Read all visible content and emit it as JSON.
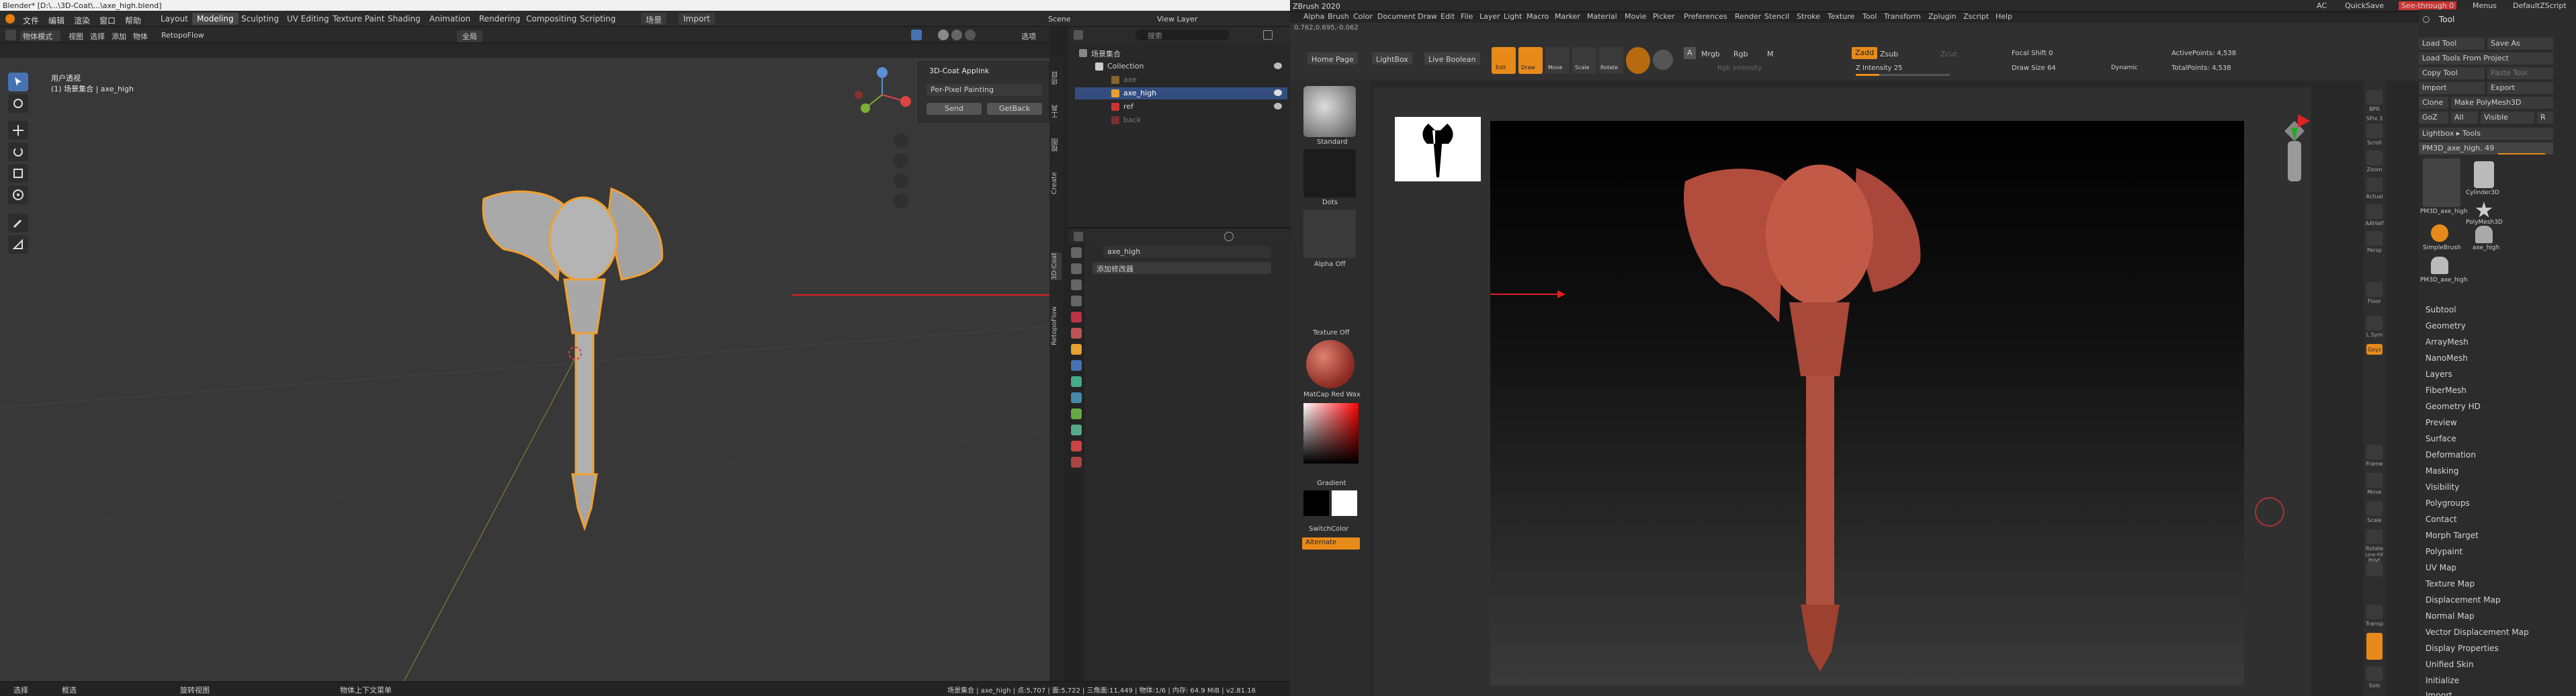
{
  "blender": {
    "window_title": "Blender* [D:\\...\\3D-Coat\\...\\axe_high.blend]",
    "menu": [
      "文件",
      "编辑",
      "渲染",
      "窗口",
      "帮助"
    ],
    "workspaces": [
      "Layout",
      "Modeling",
      "Sculpting",
      "UV Editing",
      "Texture Paint",
      "Shading",
      "Animation",
      "Rendering",
      "Compositing",
      "Scripting"
    ],
    "active_workspace": "Modeling",
    "header_buttons": [
      "场景",
      "Import"
    ],
    "scene_label": "Scene",
    "view_layer": "View Layer",
    "viewport": {
      "mode": "物体模式",
      "menus": [
        "视图",
        "选择",
        "添加",
        "物体"
      ],
      "addon_menu": "RetopoFlow",
      "view_name": "用户透视",
      "collection_info": "(1) 场景集合 | axe_high",
      "orientation": "全局"
    },
    "coat_panel": {
      "title": "3D-Coat Applink",
      "mode": "Per-Pixel Painting",
      "send": "Send",
      "getback": "GetBack",
      "option_label": "选项"
    },
    "sidebar_tabs": [
      "项目",
      "工具",
      "视图",
      "Create",
      "3D-Coat",
      "RetopoFlow"
    ],
    "outliner": {
      "search_placeholder": "搜索",
      "rows": [
        {
          "label": "场景集合",
          "indent": 0
        },
        {
          "label": "Collection",
          "indent": 1
        },
        {
          "label": "axe",
          "indent": 2
        },
        {
          "label": "axe_high",
          "indent": 2
        },
        {
          "label": "ref",
          "indent": 2
        },
        {
          "label": "back",
          "indent": 2
        }
      ]
    },
    "properties": {
      "object": "axe_high",
      "modifier_add": "添加修改器"
    },
    "status": {
      "left1": "选择",
      "left2": "框选",
      "mid": "旋转视图",
      "mid2": "物体上下文菜单",
      "right": "场景集合 | axe_high | 点:5,707 | 面:5,722 | 三角面:11,449 | 物体:1/6 | 内存: 64.9 MiB | v2.81.16"
    }
  },
  "zbrush": {
    "title": "ZBrush 2020",
    "menu": [
      "Alpha",
      "Brush",
      "Color",
      "Document",
      "Draw",
      "Edit",
      "File",
      "Layer",
      "Light",
      "Macro",
      "Marker",
      "Material",
      "Movie",
      "Picker",
      "Preferences",
      "Render",
      "Stencil",
      "Stroke",
      "Texture",
      "Tool",
      "Transform",
      "Zplugin",
      "Zscript",
      "Help"
    ],
    "top_right": [
      "AC",
      "QuickSave",
      "See-through 0",
      "Menus",
      "DefaultZScript"
    ],
    "coords": "0.762,0.695,-0.062",
    "shelf_tabs": [
      "Home Page",
      "LightBox",
      "Live Boolean"
    ],
    "shelf_buttons": [
      "Edit",
      "Draw",
      "Move",
      "Scale",
      "Rotate"
    ],
    "mrgb": [
      "A",
      "Mrgb",
      "Rgb",
      "M"
    ],
    "zadd": "Zadd",
    "zsub": "Zsub",
    "zcut": "Zcut",
    "rgb_intensity": "Rgb Intensity",
    "z_intensity": "Z Intensity 25",
    "focal_shift": "Focal Shift 0",
    "draw_size": "Draw Size 64",
    "dynamic": "Dynamic",
    "active_points": "ActivePoints: 4,538",
    "total_points": "TotalPoints: 4,538",
    "left_labels": [
      "Standard",
      "Dots",
      "Alpha Off",
      "Texture Off",
      "MatCap Red Wax",
      "Gradient",
      "SwitchColor",
      "Alternate"
    ],
    "right_icons": [
      "BPR",
      "SPix 3",
      "Scroll",
      "Zoom",
      "Actual",
      "AAHalf",
      "Persp",
      "Floor",
      "L.Sym",
      "Gxyz",
      "Frame",
      "Move",
      "Scale",
      "Rotate",
      "Line Fill PolyF",
      "Transp",
      "Solo"
    ],
    "tool_title": "Tool",
    "tool_buttons": [
      [
        "Load Tool",
        "Save As"
      ],
      [
        "Load Tools From Project"
      ],
      [
        "Copy Tool",
        "Paste Tool"
      ],
      [
        "Import",
        "Export"
      ],
      [
        "Clone",
        "Make PolyMesh3D"
      ],
      [
        "GoZ",
        "All",
        "Visible",
        "R"
      ]
    ],
    "lightbox_tools": "Lightbox ▸ Tools",
    "current_tool": "PM3D_axe_high. 49",
    "tool_thumbs": [
      "PM3D_axe_high",
      "Cylinder3D",
      "PolyMesh3D",
      "SimpleBrush",
      "axe_high",
      "PM3D_axe_high"
    ],
    "subpalettes": [
      "Subtool",
      "Geometry",
      "ArrayMesh",
      "NanoMesh",
      "Layers",
      "FiberMesh",
      "Geometry HD",
      "Preview",
      "Surface",
      "Deformation",
      "Masking",
      "Visibility",
      "Polygroups",
      "Contact",
      "Morph Target",
      "Polypaint",
      "UV Map",
      "Texture Map",
      "Displacement Map",
      "Normal Map",
      "Vector Displacement Map",
      "Display Properties",
      "Unified Skin",
      "Initialize",
      "Import"
    ]
  },
  "colors": {
    "accent_orange": "#e88a1a",
    "blender_select": "#f0a030",
    "zbrush_wax": "#b24c3c",
    "arrow_red": "#e02020"
  }
}
